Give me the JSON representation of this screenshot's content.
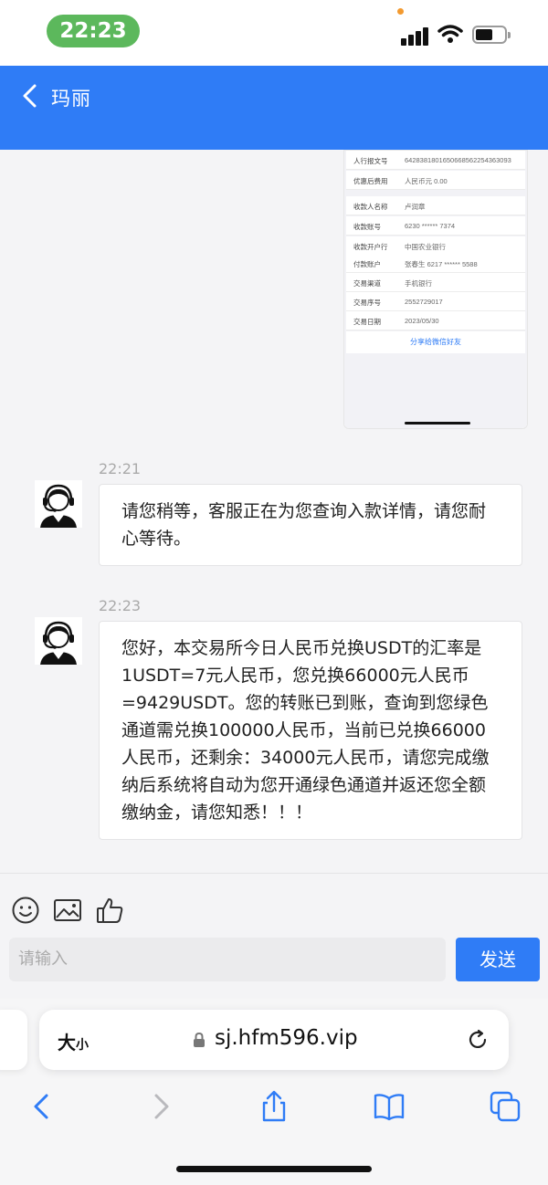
{
  "status_bar": {
    "time": "22:23"
  },
  "header": {
    "title": "玛丽"
  },
  "receipt": {
    "rows_top": [
      {
        "label": "人行报文号",
        "value": "6428381801650668562254363093"
      },
      {
        "label": "优惠后费用",
        "value": "人民币元 0.00"
      }
    ],
    "rows": [
      {
        "label": "收款人名称",
        "value": "卢润章"
      },
      {
        "label": "收款账号",
        "value": "6230 ****** 7374"
      },
      {
        "label": "收款开户行",
        "value": "中国农业银行"
      },
      {
        "label": "付款账户",
        "value": "张春生 6217 ****** 5588"
      },
      {
        "label": "交易渠道",
        "value": "手机银行"
      },
      {
        "label": "交易序号",
        "value": "2552729017"
      },
      {
        "label": "交易日期",
        "value": "2023/05/30"
      }
    ],
    "share_label": "分享给微信好友"
  },
  "messages": [
    {
      "time": "22:21",
      "text": "请您稍等，客服正在为您查询入款详情，请您耐心等待。"
    },
    {
      "time": "22:23",
      "text": "您好，本交易所今日人民币兑换USDT的汇率是1USDT=7元人民币，您兑换66000元人民币=9429USDT。您的转账已到账，查询到您绿色通道需兑换100000人民币，当前已兑换66000人民币，还剩余：34000元人民币，请您完成缴纳后系统将自动为您开通绿色通道并返还您全额缴纳金，请您知悉！！！"
    }
  ],
  "composer": {
    "placeholder": "请输入",
    "send_label": "发送"
  },
  "browser": {
    "aa_big": "大",
    "aa_small": "小",
    "url": "sj.hfm596.vip"
  },
  "colors": {
    "accent": "#2f7cf6",
    "time_pill": "#5cb85c"
  }
}
